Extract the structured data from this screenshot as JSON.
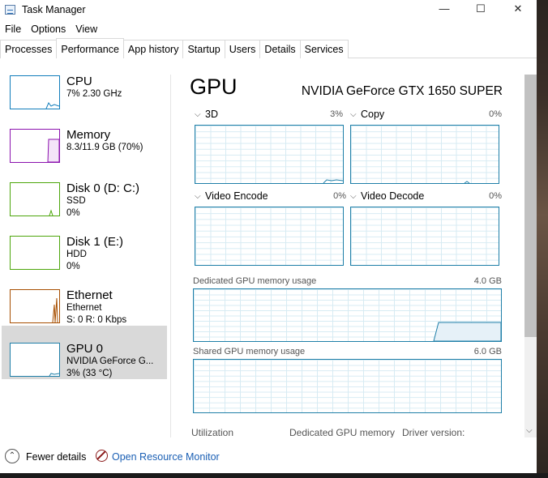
{
  "window": {
    "title": "Task Manager",
    "minimize": "—",
    "maximize": "☐",
    "close": "✕"
  },
  "menu": [
    "File",
    "Options",
    "View"
  ],
  "tabs": [
    "Processes",
    "Performance",
    "App history",
    "Startup",
    "Users",
    "Details",
    "Services"
  ],
  "active_tab": "Performance",
  "devices": [
    {
      "name": "CPU",
      "line1": "7%  2.30 GHz",
      "line2": "",
      "color": "#117dbb"
    },
    {
      "name": "Memory",
      "line1": "8.3/11.9 GB (70%)",
      "line2": "",
      "color": "#8b12ae"
    },
    {
      "name": "Disk 0 (D: C:)",
      "line1": "SSD",
      "line2": "0%",
      "color": "#4da60c"
    },
    {
      "name": "Disk 1 (E:)",
      "line1": "HDD",
      "line2": "0%",
      "color": "#4da60c"
    },
    {
      "name": "Ethernet",
      "line1": "Ethernet",
      "line2": "S: 0  R: 0 Kbps",
      "color": "#a74f01"
    },
    {
      "name": "GPU 0",
      "line1": "NVIDIA GeForce G...",
      "line2": "3%  (33 °C)",
      "color": "#1f7fa8"
    }
  ],
  "gpu": {
    "title": "GPU",
    "model": "NVIDIA GeForce GTX 1650 SUPER",
    "engines": [
      {
        "label": "3D",
        "pct": "3%"
      },
      {
        "label": "Copy",
        "pct": "0%"
      },
      {
        "label": "Video Encode",
        "pct": "0%"
      },
      {
        "label": "Video Decode",
        "pct": "0%"
      }
    ],
    "dedicated_label": "Dedicated GPU memory usage",
    "dedicated_max": "4.0 GB",
    "shared_label": "Shared GPU memory usage",
    "shared_max": "6.0 GB",
    "stats": {
      "utilization": "Utilization",
      "dedicated": "Dedicated GPU memory",
      "driver": "Driver version:"
    }
  },
  "bottom": {
    "fewer_details": "Fewer details",
    "open_resource_monitor": "Open Resource Monitor"
  }
}
